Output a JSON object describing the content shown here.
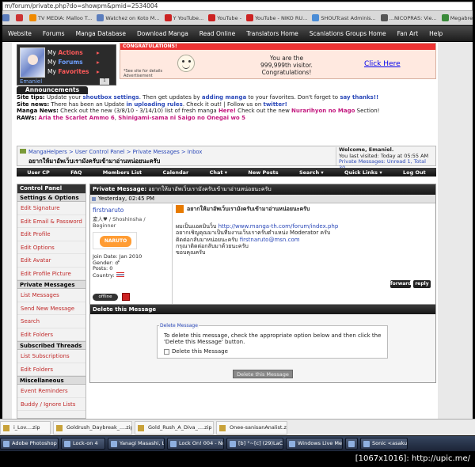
{
  "browser": {
    "address": "m/forum/private.php?do=showpm&pmid=2534004",
    "bookmarks": [
      {
        "label": "",
        "color": "#5b7dbd"
      },
      {
        "label": "",
        "color": "#cc3333"
      },
      {
        "label": "TV MEDIA: Malloo T...",
        "color": "#f08a00"
      },
      {
        "label": "Watchez on Koto M...",
        "color": "#5b7dbd"
      },
      {
        "label": "Y YouTube...",
        "color": "#cc2222"
      },
      {
        "label": "YouTube - ",
        "color": "#cc2222"
      },
      {
        "label": "YouTube - NIKO RU...",
        "color": "#cc2222"
      },
      {
        "label": "SHOUTcast Adminis...",
        "color": "#4a8cd6"
      },
      {
        "label": "...NICOPRAS: Vie...",
        "color": "#555555"
      },
      {
        "label": "Megabrecht ...",
        "color": "#3a8a3a"
      }
    ]
  },
  "sitenav": [
    "Website",
    "Forums",
    "Manga Database",
    "Download Manga",
    "Read Online",
    "Translators Home",
    "Scanlations Groups Home",
    "Fan Art",
    "Help"
  ],
  "userbox": {
    "links": [
      {
        "a": "My",
        "b": "Actions",
        "blue": false
      },
      {
        "a": "My",
        "b": "Forums",
        "blue": true
      },
      {
        "a": "My",
        "b": "Favorites",
        "blue": false
      }
    ],
    "arrow": "▸",
    "username": "Emaniel",
    "mail": "1"
  },
  "congrats": {
    "header": "CONGRATULATIONS!",
    "line1": "You are the",
    "line2": "999,999th visitor.",
    "line3": "Congratulations!",
    "click": "Click Here",
    "note1": "*See site for details",
    "note2": "Advertisement"
  },
  "announcements": {
    "title": "Announcements",
    "tips_label": "Site tips:",
    "tips_a": "Update your ",
    "tips_l1": "shoutbox settings",
    "tips_b": ". Then get updates by ",
    "tips_l2": "adding manga",
    "tips_c": " to your favorites. Don't forget to ",
    "tips_l3": "say thanks!!",
    "news_label": "Site news:",
    "news_a": "There has been an Update ",
    "news_l1": "in uploading rules",
    "news_b": ". Check it out! | Follow us on ",
    "news_l2": "twitter!",
    "manga_label": "Manga News:",
    "manga_a": "Check out the new (3/8/10 - 3/14/10) list of fresh manga ",
    "manga_l1": "Here!",
    "manga_b": " Check out the new ",
    "manga_l2": "Nurarihyon no Mago",
    "manga_c": " Section!",
    "raws_label": "RAWs:",
    "raws_a": "Aria the Scarlet Ammo 6",
    "raws_sep": ", ",
    "raws_b": "Shinigami-sama ni Saigo no Onegai wo 5"
  },
  "breadcrumb": {
    "path": "MangaHelpers > User Control Panel > Private Messages > Inbox",
    "current": "อยากให้มาอัพเว็บเรามังครับเข้ามาอ่านหน่อยนะครับ"
  },
  "welcome": {
    "line1": "Welcome, Emaniel.",
    "line2": "You last visited: Today at 05:55 AM",
    "line3": "Private Messages: Unread 1, Total 30."
  },
  "subnav": [
    "User CP",
    "FAQ",
    "Members List",
    "Calendar",
    "Chat ▾",
    "New Posts",
    "Search ▾",
    "Quick Links ▾",
    "Log Out"
  ],
  "controlpanel": {
    "title": "Control Panel",
    "sec1": "Settings & Options",
    "items1": [
      "Edit Signature",
      "Edit Email & Password",
      "Edit Profile",
      "Edit Options",
      "Edit Avatar",
      "Edit Profile Picture"
    ],
    "sec2": "Private Messages",
    "items2": [
      "List Messages",
      "Send New Message",
      "Search",
      "Edit Folders"
    ],
    "sec3": "Subscribed Threads",
    "items3": [
      "List Subscriptions",
      "Edit Folders"
    ],
    "sec4": "Miscellaneous",
    "items4": [
      "Event Reminders",
      "Buddy / Ignore Lists"
    ]
  },
  "pm": {
    "header_label": "Private Message:",
    "header_title": "อยากให้มาอัพเว็บเรามังครับเข้ามาอ่านหน่อยนะครับ",
    "date": "Yesterday, 02:45 PM",
    "sender": "firstnaruto",
    "sender_title": "素人♥ / Shoshinsha / Beginner",
    "sender_img": "NARUTO",
    "join": "Join Date: Jan 2010",
    "gender": "Gender: ♂",
    "posts": "Posts: 0",
    "country": "Country:",
    "status": "offline",
    "msg_title": "อยากให้มาอัพเว็บเรามังครับเข้ามาอ่านหน่อยนะครับ",
    "line1a": "ผมเป็นแอดมินว็บ ",
    "line1url": "http://www.manga-th.com/forum/index.php",
    "line2": "อยากเชิญคุณมาเป็นทีมงานเว็บเราครับตำแหน่ง Moderator ครับ",
    "line3a": "ติดต่อกลับมาหน่อยนะครับ  ",
    "line3email": "firstnaruto@msn.com",
    "line4": "กรุณาติดต่อกลับมาด้วยนะครับ",
    "line5": "ขอบคุณครับ",
    "forward": "forward",
    "reply": "reply"
  },
  "delete": {
    "title": "Delete this Message",
    "legend": "Delete Message",
    "text": "To delete this message, check the appropriate option below and then click the 'Delete this Message' button.",
    "checkbox": "Delete this Message",
    "button": "Delete this Message"
  },
  "downloads": [
    "i_Lov....zip",
    "Goldrush_Daybreak_....zip",
    "Gold_Rush_A_Diva_....zip",
    "Onee-sanisanAnalist.zip"
  ],
  "taskbar": [
    "Adobe Photoshop C...",
    "Lock-on 4",
    "Yanagi Masashi, Lov...",
    "Lock On! 004 - Note...",
    "[b] °~[c] (29)LaCu...",
    "Windows Live Mess...",
    "",
    "Sonic <asakura..."
  ],
  "signature": "[1067x1016]: http://upic.me/"
}
